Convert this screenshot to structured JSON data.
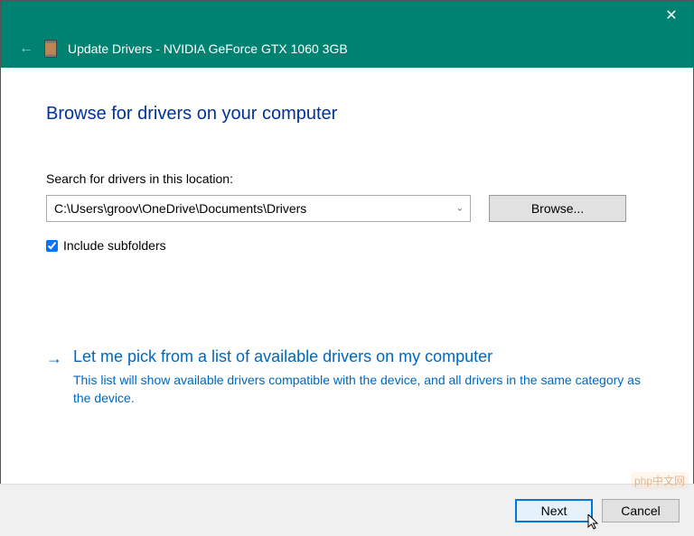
{
  "titlebar": {
    "close": "✕"
  },
  "header": {
    "back": "←",
    "title": "Update Drivers - NVIDIA GeForce GTX 1060 3GB"
  },
  "main": {
    "title": "Browse for drivers on your computer",
    "search_label": "Search for drivers in this location:",
    "path_value": "C:\\Users\\groov\\OneDrive\\Documents\\Drivers",
    "browse_label": "Browse...",
    "include_subfolders_label": "Include subfolders",
    "include_subfolders_checked": true
  },
  "option": {
    "arrow": "→",
    "title": "Let me pick from a list of available drivers on my computer",
    "description": "This list will show available drivers compatible with the device, and all drivers in the same category as the device."
  },
  "footer": {
    "next": "Next",
    "cancel": "Cancel"
  },
  "watermark": "php中文网"
}
